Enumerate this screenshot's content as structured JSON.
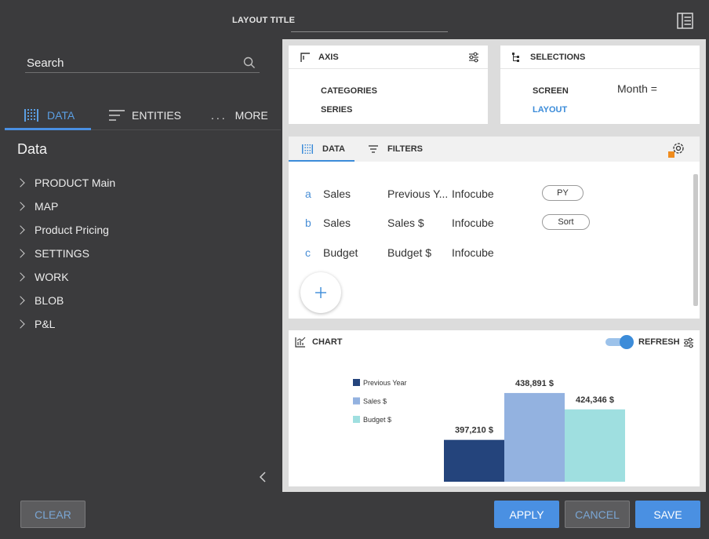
{
  "header": {
    "layout_title_label": "LAYOUT TITLE"
  },
  "left_panel": {
    "search_placeholder": "Search",
    "tabs": [
      {
        "label": "DATA",
        "icon": "data-grid-icon",
        "active": true
      },
      {
        "label": "ENTITIES",
        "icon": "lines-icon",
        "active": false
      },
      {
        "label": "MORE",
        "icon": "ellipsis-icon",
        "active": false
      }
    ],
    "section_title": "Data",
    "tree_items": [
      "PRODUCT Main",
      "MAP",
      "Product Pricing",
      "SETTINGS",
      "WORK",
      "BLOB",
      "P&L"
    ]
  },
  "axis": {
    "title": "AXIS",
    "rows": [
      "CATEGORIES",
      "SERIES"
    ]
  },
  "selections": {
    "title": "SELECTIONS",
    "screen_label": "SCREEN",
    "layout_label": "LAYOUT",
    "month_value": "Month ="
  },
  "data_panel": {
    "tabs": [
      "DATA",
      "FILTERS"
    ],
    "rows": [
      {
        "letter": "a",
        "name": "Sales",
        "measure": "Previous Y...",
        "source": "Infocube",
        "pill": "PY"
      },
      {
        "letter": "b",
        "name": "Sales",
        "measure": "Sales $",
        "source": "Infocube",
        "pill": "Sort"
      },
      {
        "letter": "c",
        "name": "Budget",
        "measure": "Budget $",
        "source": "Infocube",
        "pill": ""
      }
    ]
  },
  "chart_panel": {
    "title": "CHART",
    "refresh_label": "REFRESH",
    "refresh_on": true
  },
  "chart_data": {
    "type": "bar",
    "categories": [
      "Previous Year",
      "Sales $",
      "Budget $"
    ],
    "values": [
      397210,
      438891,
      424346
    ],
    "labels": [
      "397,210 $",
      "438,891 $",
      "424,346 $"
    ],
    "colors": [
      "#24447c",
      "#93b2e0",
      "#9fdfe0"
    ],
    "legend": [
      "Previous Year",
      "Sales $",
      "Budget $"
    ],
    "legend_position": "left",
    "ylim": [
      360000,
      450000
    ]
  },
  "footer": {
    "clear": "CLEAR",
    "apply": "APPLY",
    "cancel": "CANCEL",
    "save": "SAVE"
  },
  "colors": {
    "accent": "#4a90e2",
    "background": "#3b3b3d"
  }
}
